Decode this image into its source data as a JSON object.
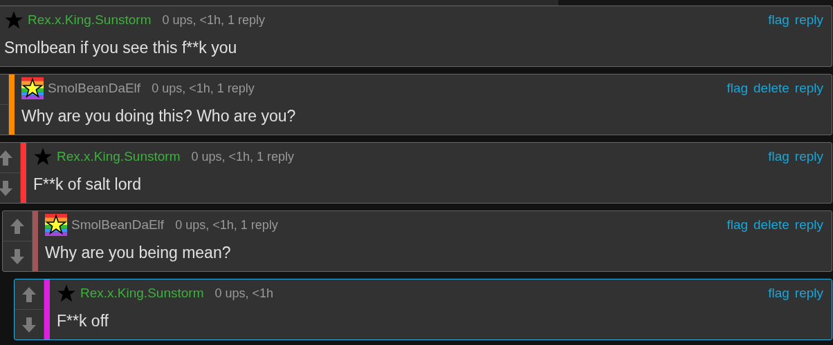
{
  "comments": [
    {
      "author": "Rex.x.King.Sunstorm",
      "author_op": true,
      "kind": "black-star",
      "meta": "0 ups, <1h, 1 reply",
      "text": "Smolbean if you see this f**k you",
      "actions": [
        "flag",
        "reply"
      ],
      "highlighted": false,
      "children": [
        {
          "author": "SmolBeanDaElf",
          "author_op": false,
          "kind": "rainbow-star",
          "color": "#ff8c00",
          "meta": "0 ups, <1h, 1 reply",
          "text": "Why are you doing this? Who are you?",
          "actions": [
            "flag",
            "delete",
            "reply"
          ],
          "highlighted": false,
          "children": [
            {
              "author": "Rex.x.King.Sunstorm",
              "author_op": true,
              "kind": "black-star",
              "color": "#ff3333",
              "meta": "0 ups, <1h, 1 reply",
              "text": "F**k of salt lord",
              "actions": [
                "flag",
                "reply"
              ],
              "highlighted": false,
              "children": [
                {
                  "author": "SmolBeanDaElf",
                  "author_op": false,
                  "kind": "rainbow-star",
                  "color": "#a05656",
                  "meta": "0 ups, <1h, 1 reply",
                  "text": "Why are you being mean?",
                  "actions": [
                    "flag",
                    "delete",
                    "reply"
                  ],
                  "highlighted": false,
                  "children": [
                    {
                      "author": "Rex.x.King.Sunstorm",
                      "author_op": true,
                      "kind": "black-star",
                      "color": "#e020e0",
                      "meta": "0 ups, <1h",
                      "text": "F**k off",
                      "actions": [
                        "flag",
                        "reply"
                      ],
                      "highlighted": true
                    }
                  ]
                }
              ]
            }
          ]
        }
      ]
    }
  ]
}
